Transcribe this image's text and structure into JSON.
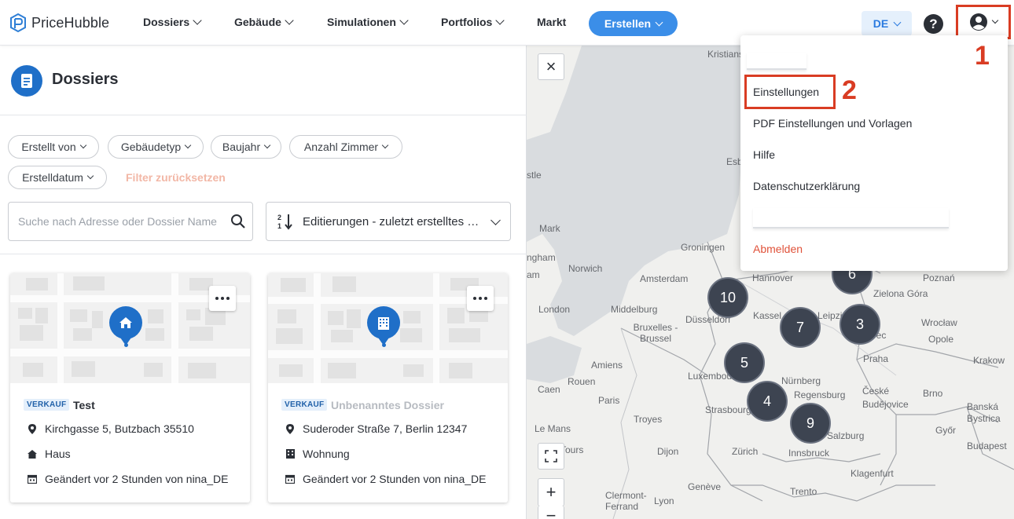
{
  "header": {
    "brand": "PriceHubble",
    "nav": [
      "Dossiers",
      "Gebäude",
      "Simulationen",
      "Portfolios",
      "Markt"
    ],
    "create_label": "Erstellen",
    "lang_label": "DE",
    "help_label": "?"
  },
  "annotations": {
    "one": "1",
    "two": "2"
  },
  "panel": {
    "title": "Dossiers",
    "filters": [
      "Erstellt von",
      "Gebäudetyp",
      "Baujahr",
      "Anzahl Zimmer",
      "Erstelldatum"
    ],
    "reset_label": "Filter zurücksetzen",
    "search_placeholder": "Suche nach Adresse oder Dossier Name",
    "sort_label": "Editierungen - zuletzt erstelltes Dossier"
  },
  "cards": [
    {
      "badge": "VERKAUF",
      "title": "Test",
      "address": "Kirchgasse 5, Butzbach 35510",
      "type": "Haus",
      "changed": "Geändert vor 2 Stunden von nina_DE"
    },
    {
      "badge": "VERKAUF",
      "title": "Unbenanntes Dossier",
      "address": "Suderoder Straße 7, Berlin 12347",
      "type": "Wohnung",
      "changed": "Geändert vor 2 Stunden von nina_DE"
    }
  ],
  "map": {
    "labels": [
      "Kristians",
      "Esb",
      "stle",
      "ngham",
      "am",
      "Mark",
      "Norwich",
      "London",
      "Groningen",
      "Amsterdam",
      "Hannover",
      "Middelburg",
      "Düsseldorf",
      "Bruxelles - Brussel",
      "Kassel",
      "Leipzig",
      "Amiens",
      "Luxembourg",
      "Rouen",
      "Caen",
      "Paris",
      "Nürnberg",
      "Regensburg",
      "Strasbourg",
      "Troyes",
      "Le Mans",
      "Tours",
      "Dijon",
      "Zürich",
      "Innsbruck",
      "Salzburg",
      "Clermont-Ferrand",
      "Lyon",
      "Genève",
      "Trento",
      "Klagenfurt",
      "Poznań",
      "Zielona Góra",
      "Wrocław",
      "Liberec",
      "Opole",
      "Praha",
      "Krakow",
      "České Budějovice",
      "Banská Bystrica",
      "Brno",
      "Budapest",
      "Győr"
    ],
    "clusters": [
      "10",
      "7",
      "3",
      "5",
      "4",
      "9",
      "6"
    ],
    "zoom_in": "+",
    "zoom_out": "−",
    "close": "×"
  },
  "user_menu": {
    "items": [
      "Einstellungen",
      "PDF Einstellungen und Vorlagen",
      "Hilfe",
      "Datenschutzerklärung"
    ],
    "logout": "Abmelden"
  },
  "colors": {
    "brand_blue": "#1f6fc8",
    "accent": "#3b8ee8",
    "annotation_red": "#d93c23",
    "logout_red": "#e0523a"
  }
}
